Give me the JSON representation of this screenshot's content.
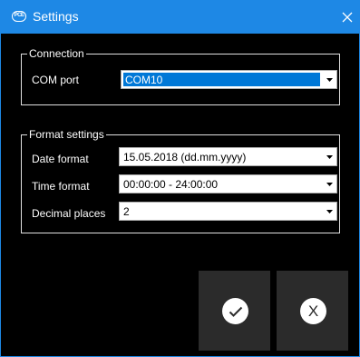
{
  "window": {
    "title": "Settings",
    "app_icon_text": "PCE"
  },
  "connection": {
    "legend": "Connection",
    "com_port_label": "COM port",
    "com_port_value": "COM10"
  },
  "format": {
    "legend": "Format settings",
    "date_label": "Date format",
    "date_value": "15.05.2018 (dd.mm.yyyy)",
    "time_label": "Time format",
    "time_value": "00:00:00 - 24:00:00",
    "decimal_label": "Decimal places",
    "decimal_value": "2"
  },
  "buttons": {
    "ok_icon": "checkmark-icon",
    "cancel_icon": "x-icon",
    "cancel_glyph": "X"
  },
  "colors": {
    "titlebar": "#1e88e5",
    "background": "#000000",
    "button_bg": "#2b2b2b",
    "selection": "#0078d7"
  }
}
